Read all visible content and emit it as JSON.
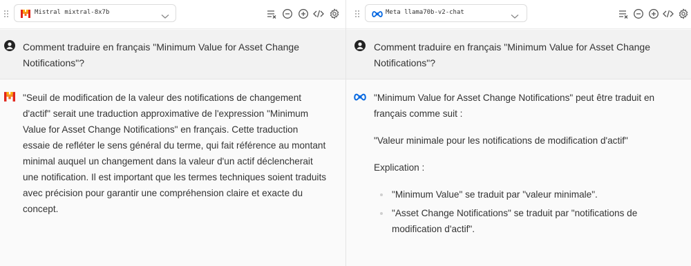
{
  "panes": {
    "left": {
      "provider": "Mistral",
      "model": "mixtral-8x7b",
      "user_message": "Comment traduire en français \"Minimum Value for Asset Change Notifications\"?",
      "assistant_message": "\"Seuil de modification de la valeur des notifications de changement d'actif\" serait une traduction approximative de l'expression \"Minimum Value for Asset Change Notifications\" en français. Cette traduction essaie de refléter le sens général du terme, qui fait référence au montant minimal auquel un changement dans la valeur d'un actif déclencherait une notification. Il est important que les termes techniques soient traduits avec précision pour garantir une compréhension claire et exacte du concept.",
      "icons": [
        "drag-handle-icon",
        "mistral-logo-icon",
        "chevron-down-icon",
        "clear-list-icon",
        "minus-circle-icon",
        "plus-circle-icon",
        "code-icon",
        "gear-icon",
        "user-icon"
      ]
    },
    "right": {
      "provider": "Meta",
      "model": "llama70b-v2-chat",
      "user_message": "Comment traduire en français \"Minimum Value for Asset Change Notifications\"?",
      "assistant_intro": "\"Minimum Value for Asset Change Notifications\" peut être traduit en français comme suit :",
      "assistant_quote": "\"Valeur minimale pour les notifications de modification d'actif\"",
      "assistant_explication": "Explication :",
      "assistant_bullets": [
        "\"Minimum Value\" se traduit par \"valeur minimale\".",
        "\"Asset Change Notifications\" se traduit par \"notifications de modification d'actif\"."
      ],
      "icons": [
        "drag-handle-icon",
        "meta-logo-icon",
        "chevron-down-icon",
        "clear-list-icon",
        "minus-circle-icon",
        "plus-circle-icon",
        "code-icon",
        "gear-icon",
        "user-icon"
      ]
    }
  },
  "colors": {
    "mistral_orange": "#f7931e",
    "mistral_red": "#e1251b",
    "meta_blue": "#0668e1",
    "icon_gray": "#555555",
    "user_row_bg": "#f2f2f2",
    "pane_bg": "#fafafa"
  }
}
